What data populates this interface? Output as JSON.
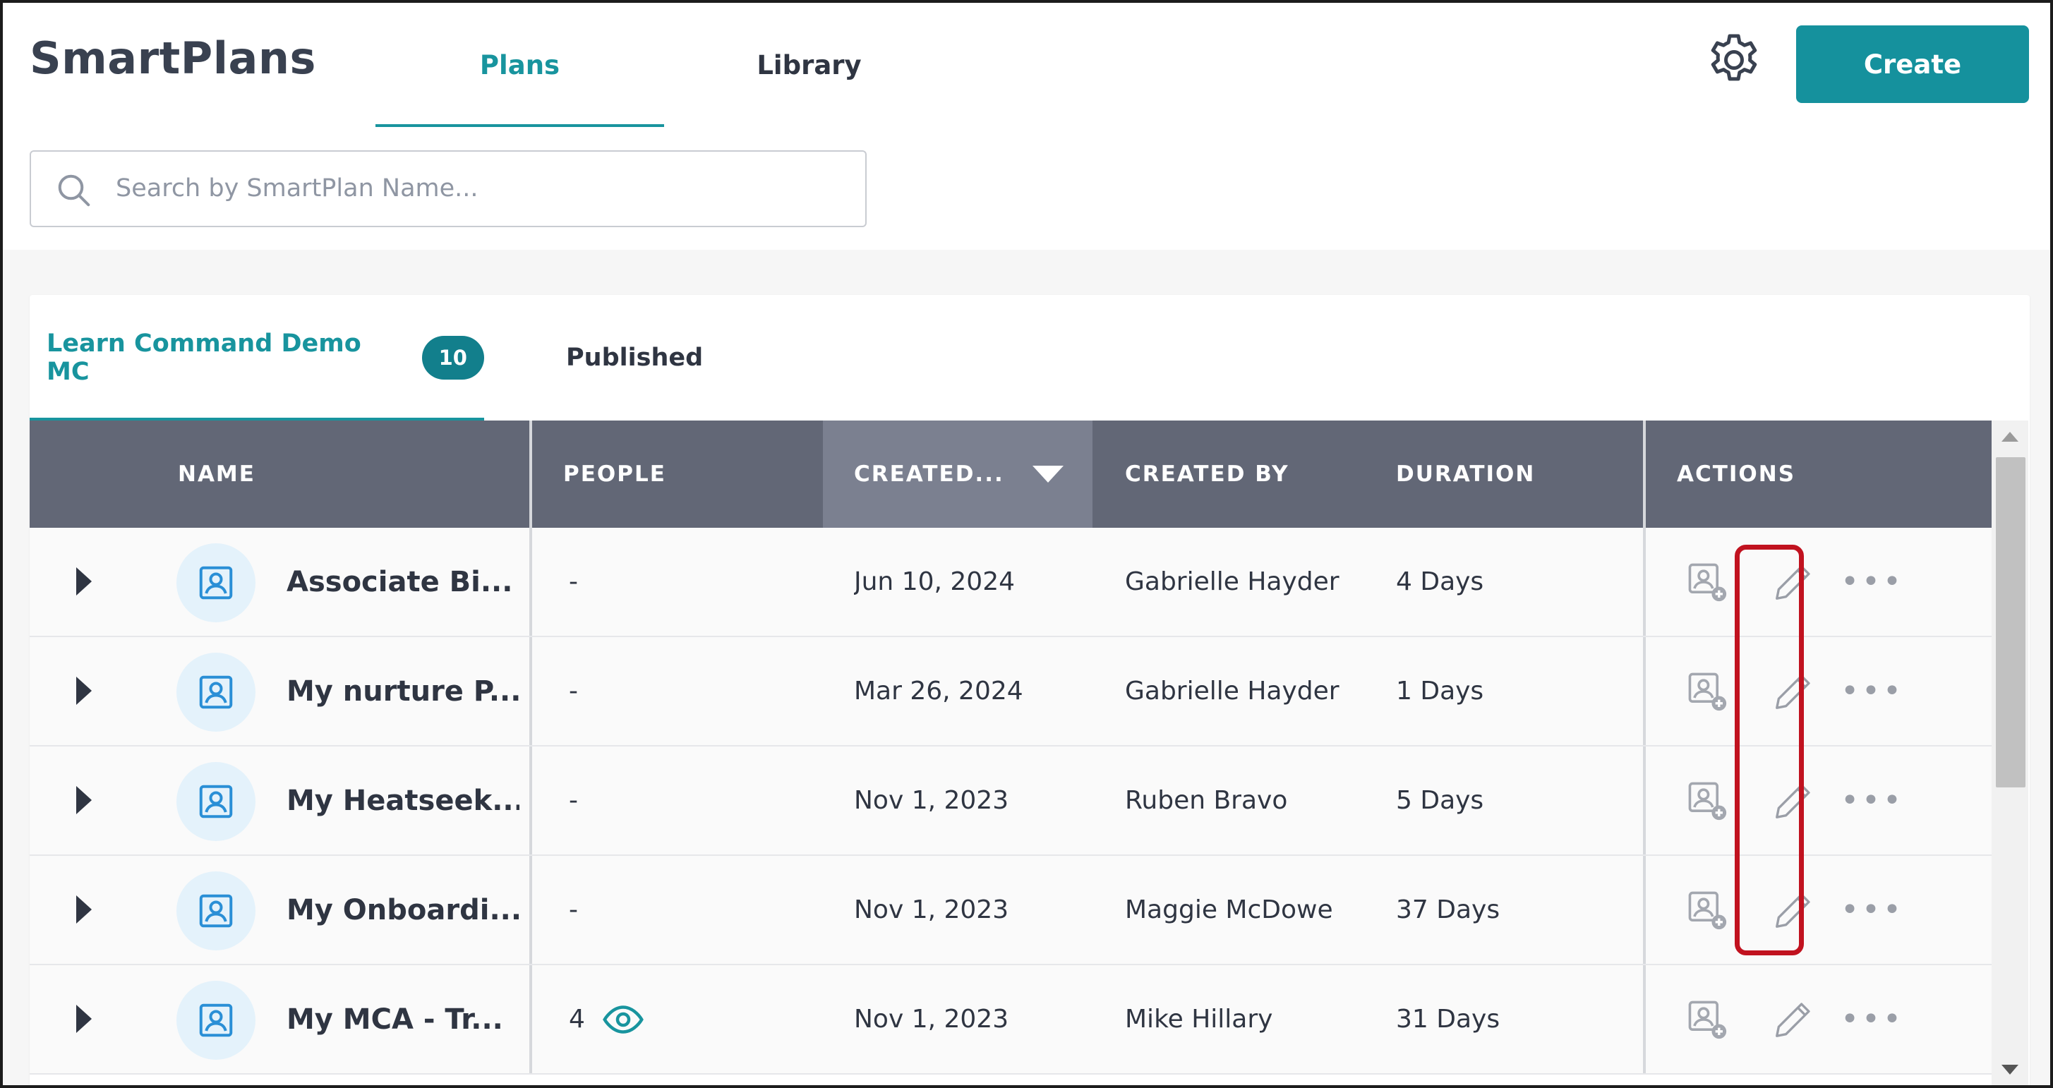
{
  "app": {
    "brand": "SmartPlans",
    "tabs": {
      "plans": "Plans",
      "library": "Library"
    },
    "create_label": "Create",
    "search_placeholder": "Search by SmartPlan Name...",
    "accent_color": "#18949e",
    "header_color": "#626776"
  },
  "subtabs": {
    "active_label": "Learn Command Demo MC",
    "active_count": "10",
    "published_label": "Published"
  },
  "table": {
    "columns": {
      "name": "NAME",
      "people": "PEOPLE",
      "created": "CREATED...",
      "created_by": "CREATED BY",
      "duration": "DURATION",
      "actions": "ACTIONS"
    },
    "sort": {
      "column": "created",
      "direction": "desc"
    },
    "rows": [
      {
        "name": "Associate Bi...",
        "people": "-",
        "created": "Jun 10, 2024",
        "created_by": "Gabrielle Hayder",
        "duration": "4 Days"
      },
      {
        "name": "My nurture P...",
        "people": "-",
        "created": "Mar 26, 2024",
        "created_by": "Gabrielle Hayder",
        "duration": "1 Days"
      },
      {
        "name": "My Heatseek...",
        "people": "-",
        "created": "Nov 1, 2023",
        "created_by": "Ruben Bravo",
        "duration": "5 Days"
      },
      {
        "name": "My Onboardi...",
        "people": "-",
        "created": "Nov 1, 2023",
        "created_by": "Maggie McDowe",
        "duration": "37 Days"
      },
      {
        "name": "My MCA - Tr...",
        "people": "4",
        "created": "Nov 1, 2023",
        "created_by": "Mike Hillary",
        "duration": "31 Days"
      }
    ],
    "actions_icons": [
      "add-person-icon",
      "pencil-edit-icon",
      "more-options-icon"
    ],
    "highlight_color": "#c1121f"
  }
}
